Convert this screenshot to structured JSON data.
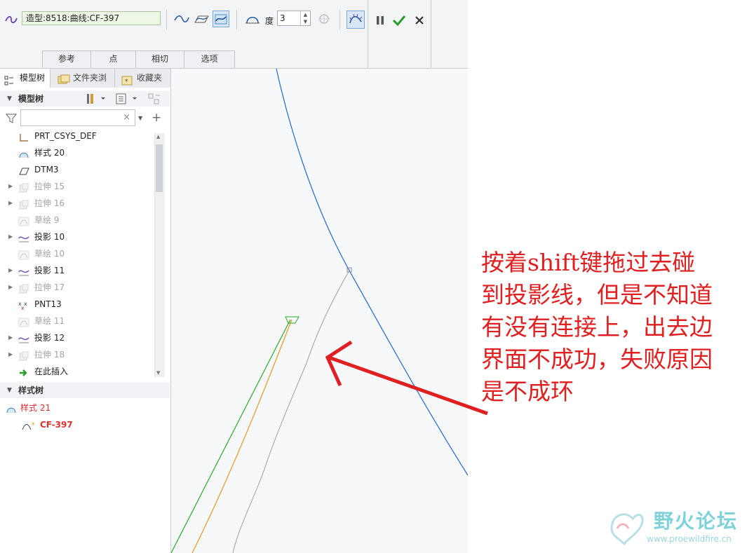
{
  "ribbon": {
    "curve_name": "造型:8518:曲线:CF-397",
    "degree_label": "度",
    "degree_value": "3",
    "tabs": [
      "参考",
      "点",
      "相切",
      "选项"
    ],
    "icons": [
      "curve-icon",
      "free-curve-icon",
      "planar-curve-icon",
      "cos-curve-icon",
      "radial-plane-icon",
      "degree-icon",
      "control-point-icon",
      "curvature-icon",
      "pause-icon",
      "ok-check-icon",
      "cancel-icon"
    ]
  },
  "panel": {
    "tabs": [
      "模型树",
      "文件夹浏",
      "收藏夹"
    ],
    "model_tree_title": "模型树",
    "filter_placeholder": "",
    "items": [
      {
        "label": "PRT_CSYS_DEF",
        "icon": "csys-icon",
        "dim": false,
        "expandable": false
      },
      {
        "label": "样式 20",
        "icon": "style-icon",
        "dim": false,
        "expandable": false
      },
      {
        "label": "DTM3",
        "icon": "datum-plane-icon",
        "dim": false,
        "expandable": false
      },
      {
        "label": "拉伸 15",
        "icon": "extrude-icon",
        "dim": true,
        "expandable": true
      },
      {
        "label": "拉伸 16",
        "icon": "extrude-icon",
        "dim": true,
        "expandable": true
      },
      {
        "label": "草绘 9",
        "icon": "sketch-icon",
        "dim": true,
        "expandable": false
      },
      {
        "label": "投影 10",
        "icon": "projection-icon",
        "dim": false,
        "expandable": true
      },
      {
        "label": "草绘 10",
        "icon": "sketch-icon",
        "dim": true,
        "expandable": false
      },
      {
        "label": "投影 11",
        "icon": "projection-icon",
        "dim": false,
        "expandable": true
      },
      {
        "label": "拉伸 17",
        "icon": "extrude-icon",
        "dim": true,
        "expandable": true
      },
      {
        "label": "PNT13",
        "icon": "datum-point-icon",
        "dim": false,
        "expandable": false
      },
      {
        "label": "草绘 11",
        "icon": "sketch-icon",
        "dim": true,
        "expandable": false
      },
      {
        "label": "投影 12",
        "icon": "projection-icon",
        "dim": false,
        "expandable": true
      },
      {
        "label": "拉伸 18",
        "icon": "extrude-icon",
        "dim": true,
        "expandable": true
      },
      {
        "label": "在此插入",
        "icon": "insert-here-icon",
        "dim": false,
        "expandable": false
      }
    ],
    "style_tree_title": "样式树",
    "style_root": "样式 21",
    "style_child": "CF-397",
    "style_root_color": "#e03030"
  },
  "annotation": {
    "lines": [
      "按着shift键拖过去碰",
      "到投影线，但是不知道",
      "有没有连接上，出去边",
      "界面不成功，失败原因",
      "是不成环"
    ],
    "color": "#e02020"
  },
  "watermark": {
    "title": "野火论坛",
    "url": "www.proewildfire.cn"
  },
  "colors": {
    "blue_curve": "#2266cc",
    "green_curve": "#2aa82a",
    "orange_curve": "#e8961e",
    "gray_curve": "#9a9da2"
  }
}
